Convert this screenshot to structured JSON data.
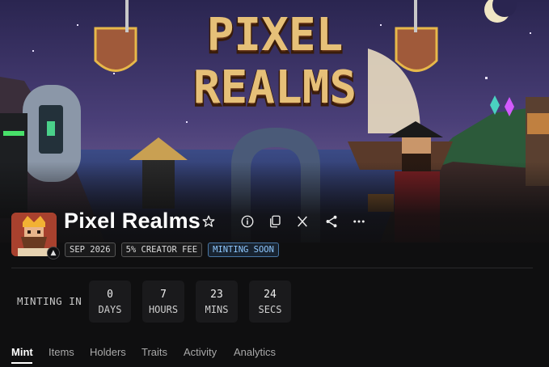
{
  "banner": {
    "logo_line1": "PIXEL",
    "logo_line2": "REALMS"
  },
  "collection": {
    "title": "Pixel Realms",
    "badges": [
      "SEP 2026",
      "5% CREATOR FEE",
      "MINTING SOON"
    ]
  },
  "countdown": {
    "label": "MINTING IN",
    "units": [
      {
        "value": "0",
        "unit": "DAYS"
      },
      {
        "value": "7",
        "unit": "HOURS"
      },
      {
        "value": "23",
        "unit": "MINS"
      },
      {
        "value": "24",
        "unit": "SECS"
      }
    ]
  },
  "tabs": [
    "Mint",
    "Items",
    "Holders",
    "Traits",
    "Activity",
    "Analytics"
  ],
  "active_tab": "Mint",
  "icons": {
    "favorite": "star-icon",
    "info": "info-icon",
    "copy": "copy-icon",
    "x": "x-logo-icon",
    "share": "share-icon",
    "more": "more-icon"
  }
}
